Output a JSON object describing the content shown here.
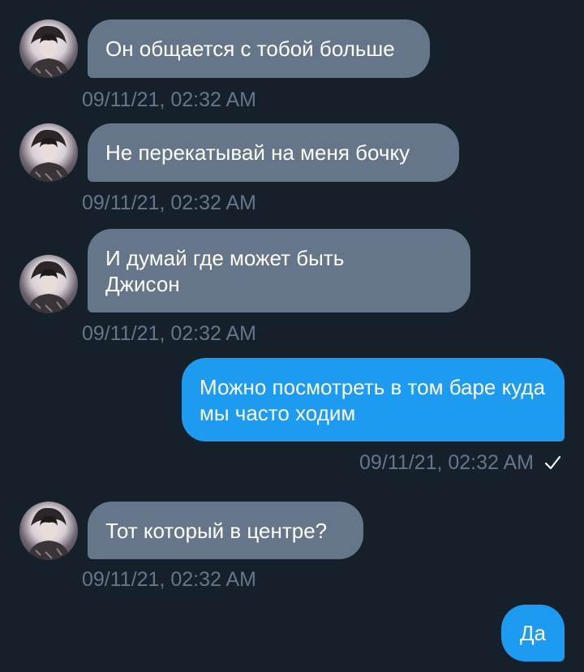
{
  "messages": [
    {
      "direction": "incoming",
      "text": "Он общается с тобой больше",
      "time": "09/11/21, 02:32 AM"
    },
    {
      "direction": "incoming",
      "text": "Не перекатывай на меня бочку",
      "time": "09/11/21, 02:32 AM"
    },
    {
      "direction": "incoming",
      "text": "И думай где может быть Джисон",
      "time": "09/11/21, 02:32 AM"
    },
    {
      "direction": "outgoing",
      "text": "Можно посмотреть в том баре куда мы часто ходим",
      "time": "09/11/21, 02:32 AM",
      "status_icon": "checkmark-icon"
    },
    {
      "direction": "incoming",
      "text": "Тот который в центре?",
      "time": "09/11/21, 02:32 AM"
    },
    {
      "direction": "outgoing",
      "text": "Да"
    }
  ],
  "colors": {
    "background": "#15202b",
    "incoming_bubble": "#66768a",
    "outgoing_bubble": "#1d9bf0",
    "timestamp": "#66768a"
  }
}
